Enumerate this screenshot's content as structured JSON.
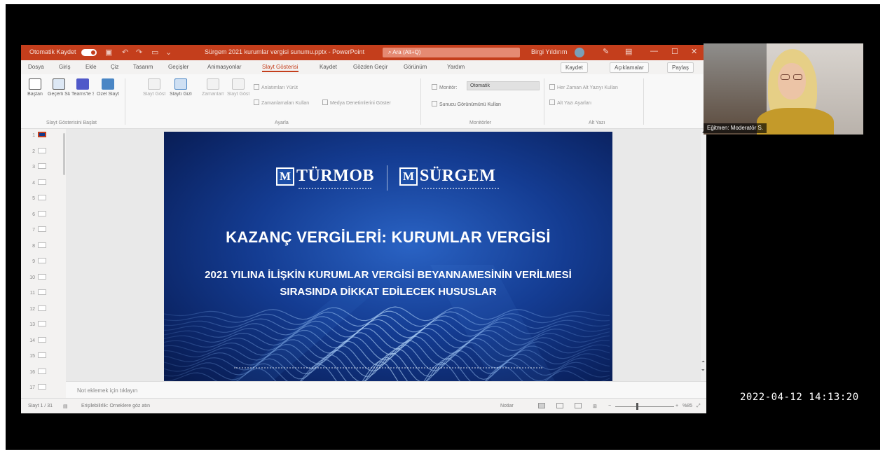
{
  "window": {
    "autosave_label": "Otomatik Kaydet",
    "title": "Sürgem 2021 kurumlar vergisi sunumu.pptx - PowerPoint",
    "search_placeholder": "Ara (Alt+Q)",
    "user_name": "Birgi Yıldırım"
  },
  "tabs": [
    "Dosya",
    "Giriş",
    "Ekle",
    "Çiz",
    "Tasarım",
    "Geçişler",
    "Animasyonlar",
    "Slayt Gösterisi",
    "Kaydet",
    "Gözden Geçir",
    "Görünüm",
    "Yardım"
  ],
  "active_tab_index": 7,
  "ribbon": {
    "record_label": "Kaydet",
    "comments_label": "Açıklamalar",
    "share_label": "Paylaş",
    "start_group": {
      "label": "Slayt Gösterisini Başlat",
      "buttons": [
        "Baştan",
        "Geçerli Slayttan",
        "Teams'te Sun",
        "Özel Slayt Gösterisi"
      ]
    },
    "setup_group": {
      "label": "Ayarla",
      "buttons": [
        "Slayt Gösterisini Ayarla",
        "Slaytı Gizle",
        "Zamanlamaları Prova Et",
        "Slayt Gösterisini Kaydet"
      ],
      "checks": [
        "Anlatımları Yürüt",
        "Zamanlamaları Kullan",
        "Medya Denetimlerini Göster"
      ]
    },
    "monitors_group": {
      "label": "Monitörler",
      "monitor_label": "Monitör:",
      "monitor_value": "Otomatik",
      "presenter_view": "Sunucu Görünümünü Kullan"
    },
    "captions_group": {
      "label": "Alt Yazı",
      "items": [
        "Her Zaman Alt Yazıyı Kullan",
        "Alt Yazı Ayarları"
      ]
    }
  },
  "thumbnails": [
    "1",
    "2",
    "3",
    "4",
    "5",
    "6",
    "7",
    "8",
    "9",
    "10",
    "11",
    "12",
    "13",
    "14",
    "15",
    "16",
    "17"
  ],
  "current_slide": 1,
  "slide": {
    "logo_left": "TÜRMOB",
    "logo_right": "SÜRGEM",
    "logo_mark": "M",
    "title": "KAZANÇ VERGİLERİ: KURUMLAR VERGİSİ",
    "subtitle_line1": "2021 YILINA İLİŞKİN KURUMLAR VERGİSİ BEYANNAMESİNİN VERİLMESİ",
    "subtitle_line2": "SIRASINDA DİKKAT EDİLECEK HUSUSLAR"
  },
  "notes_placeholder": "Not eklemek için tıklayın",
  "status": {
    "slide_counter": "Slayt 1 / 31",
    "accessibility": "Erişilebilirlik: Örneklere göz atın",
    "notes_button": "Notlar",
    "zoom": "%85"
  },
  "webcam": {
    "name": "Eğitmen: Moderatör S."
  },
  "timestamp": "2022-04-12  14:13:20",
  "colors": {
    "accent": "#c43e1c",
    "slide_blue": "#143c92"
  }
}
